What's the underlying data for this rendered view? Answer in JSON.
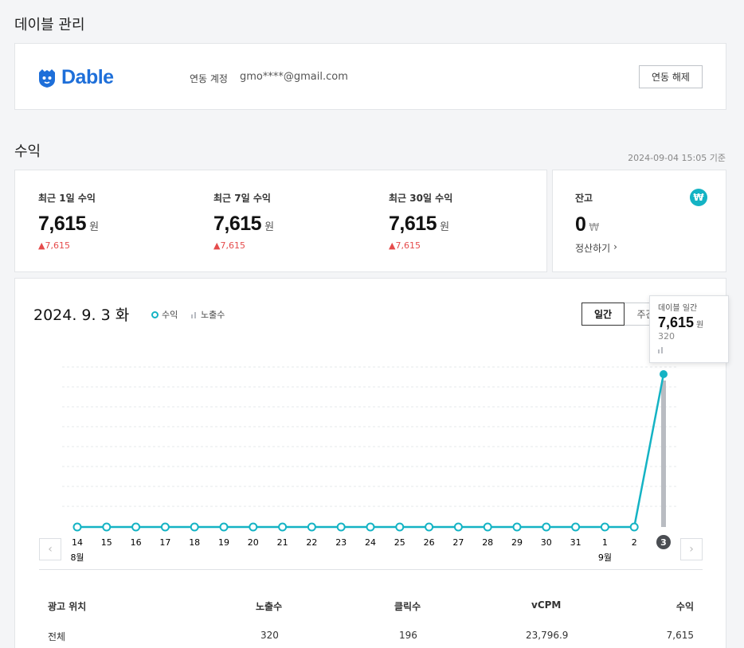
{
  "page": {
    "title": "데이블 관리"
  },
  "account": {
    "logo_text": "Dable",
    "label": "연동 계정",
    "email": "gmo****@gmail.com",
    "unlink_label": "연동 해제"
  },
  "revenue": {
    "title": "수익",
    "timestamp": "2024-09-04 15:05 기준",
    "stats": [
      {
        "label": "최근 1일 수익",
        "value": "7,615",
        "unit": "원",
        "delta": "▲7,615"
      },
      {
        "label": "최근 7일 수익",
        "value": "7,615",
        "unit": "원",
        "delta": "▲7,615"
      },
      {
        "label": "최근 30일 수익",
        "value": "7,615",
        "unit": "원",
        "delta": "▲7,615"
      }
    ],
    "balance": {
      "label": "잔고",
      "value": "0",
      "unit": "₩",
      "badge": "₩",
      "settle_label": "정산하기",
      "settle_arrow": "›"
    }
  },
  "chart": {
    "date_title": "2024. 9. 3 화",
    "legend_revenue": "수익",
    "legend_impressions": "노출수",
    "period_tabs": [
      "일간",
      "주간"
    ],
    "tooltip": {
      "label": "데이블 일간",
      "value": "7,615",
      "unit": "원",
      "impressions": "320"
    },
    "prev_arrow": "‹",
    "next_arrow": "›"
  },
  "chart_data": {
    "type": "line",
    "x": [
      "14",
      "15",
      "16",
      "17",
      "18",
      "19",
      "20",
      "21",
      "22",
      "23",
      "24",
      "25",
      "26",
      "27",
      "28",
      "29",
      "30",
      "31",
      "1",
      "2",
      "3"
    ],
    "month_labels": [
      {
        "index": 0,
        "label": "8월"
      },
      {
        "index": 18,
        "label": "9월"
      }
    ],
    "series": [
      {
        "name": "수익",
        "values": [
          0,
          0,
          0,
          0,
          0,
          0,
          0,
          0,
          0,
          0,
          0,
          0,
          0,
          0,
          0,
          0,
          0,
          0,
          0,
          0,
          7615
        ],
        "color": "#14b3c4"
      },
      {
        "name": "노출수",
        "values": [
          0,
          0,
          0,
          0,
          0,
          0,
          0,
          0,
          0,
          0,
          0,
          0,
          0,
          0,
          0,
          0,
          0,
          0,
          0,
          0,
          320
        ],
        "color": "#b9bcc2"
      }
    ],
    "selected_index": 20,
    "grid": true
  },
  "table": {
    "headers": [
      "광고 위치",
      "노출수",
      "클릭수",
      "vCPM",
      "수익"
    ],
    "rows": [
      [
        "전체",
        "320",
        "196",
        "23,796.9",
        "7,615"
      ]
    ]
  },
  "colors": {
    "accent": "#14b3c4",
    "brand": "#1e6fd9",
    "delta_up": "#e54b4b"
  }
}
